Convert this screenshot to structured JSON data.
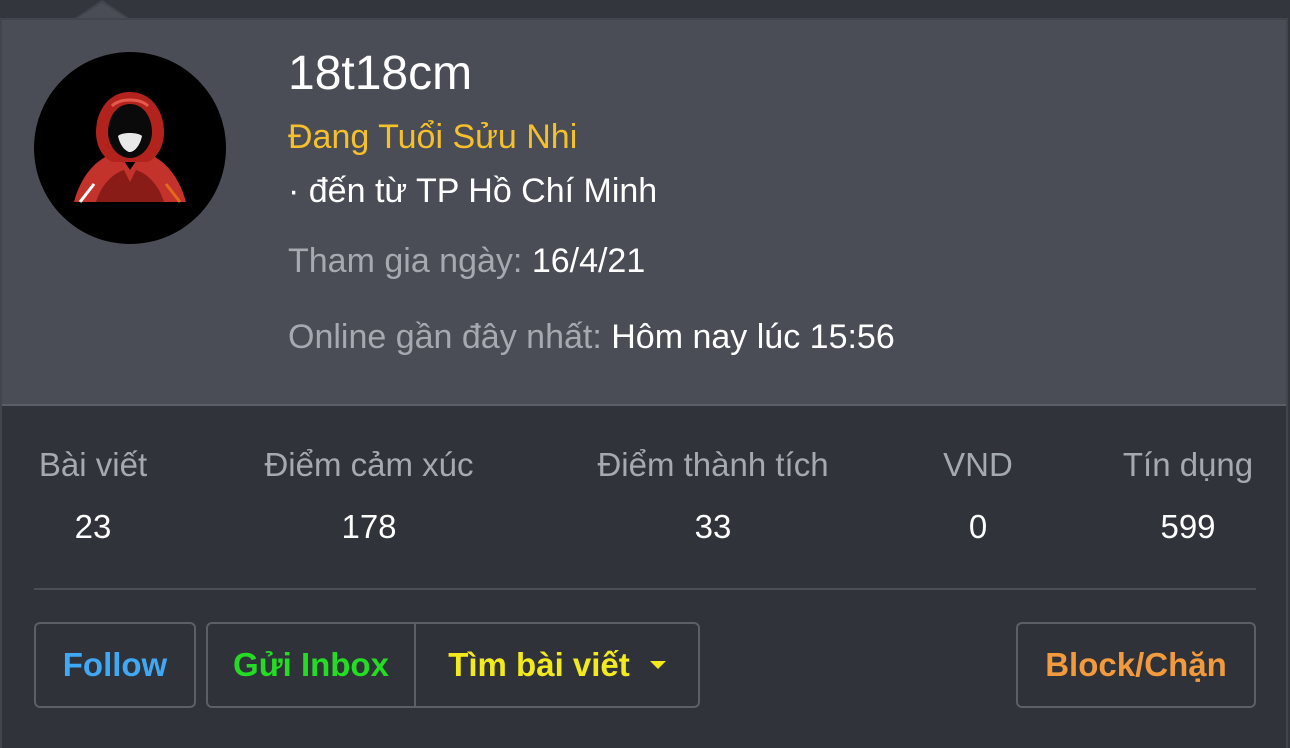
{
  "profile": {
    "username": "18t18cm",
    "user_title": "Đang Tuổi Sửu Nhi",
    "location": "· đến từ TP Hồ Chí Minh",
    "joined_label": "Tham gia ngày:",
    "joined_value": "16/4/21",
    "last_seen_label": "Online gần đây nhất:",
    "last_seen_value": "Hôm nay lúc 15:56",
    "avatar_icon": "hooded-figure-icon"
  },
  "stats": [
    {
      "label": "Bài viết",
      "value": "23"
    },
    {
      "label": "Điểm cảm xúc",
      "value": "178"
    },
    {
      "label": "Điểm thành tích",
      "value": "33"
    },
    {
      "label": "VND",
      "value": "0"
    },
    {
      "label": "Tín dụng",
      "value": "599"
    }
  ],
  "actions": {
    "follow": "Follow",
    "inbox": "Gửi Inbox",
    "find_posts": "Tìm bài viết",
    "block": "Block/Chặn"
  },
  "colors": {
    "title": "#f5c02a",
    "follow": "#3fa9f5",
    "inbox": "#22dd22",
    "find_posts": "#f2ea1a",
    "block": "#f29a3c"
  }
}
